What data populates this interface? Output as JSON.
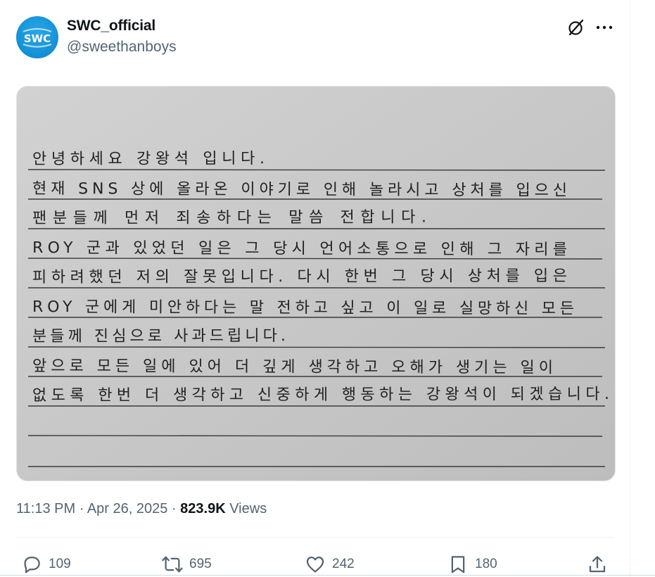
{
  "tweet": {
    "author": {
      "display_name": "SWC_official",
      "handle": "@sweethanboys",
      "avatar_logo_text": "SWC"
    },
    "media": {
      "type": "handwritten-letter-photo",
      "lines": [
        "안녕하세요 강왕석 입니다.",
        "현재 SNS 상에 올라온 이야기로 인해 놀라시고 상처를 입으신",
        "팬분들께 먼저 죄송하다는 말씀 전합니다.",
        "ROY 군과 있었던 일은 그 당시 언어소통으로 인해 그 자리를",
        "피하려했던 저의 잘못입니다. 다시 한번 그 당시 상처를 입은",
        "ROY 군에게 미안하다는 말 전하고 싶고 이 일로 실망하신 모든",
        "분들께 진심으로 사과드립니다.",
        "앞으로 모든 일에 있어 더 깊게 생각하고 오해가 생기는 일이",
        "없도록 한번 더 생각하고 신중하게 행동하는 강왕석이 되겠습니다."
      ]
    },
    "meta": {
      "time": "11:13 PM",
      "separator": "·",
      "date": "Apr 26, 2025",
      "views_count": "823.9K",
      "views_label": "Views"
    },
    "actions": {
      "reply_count": "109",
      "retweet_count": "695",
      "like_count": "242",
      "bookmark_count": "180"
    }
  },
  "icons": {
    "grok": "grok-icon",
    "more": "more-icon",
    "reply": "reply-icon",
    "retweet": "retweet-icon",
    "like": "heart-icon",
    "bookmark": "bookmark-icon",
    "share": "share-icon"
  },
  "colors": {
    "primary_text": "#0f1419",
    "secondary_text": "#536471",
    "avatar_blue": "#1a9be0",
    "paper": "#c9c9c9",
    "ink": "#222222"
  }
}
